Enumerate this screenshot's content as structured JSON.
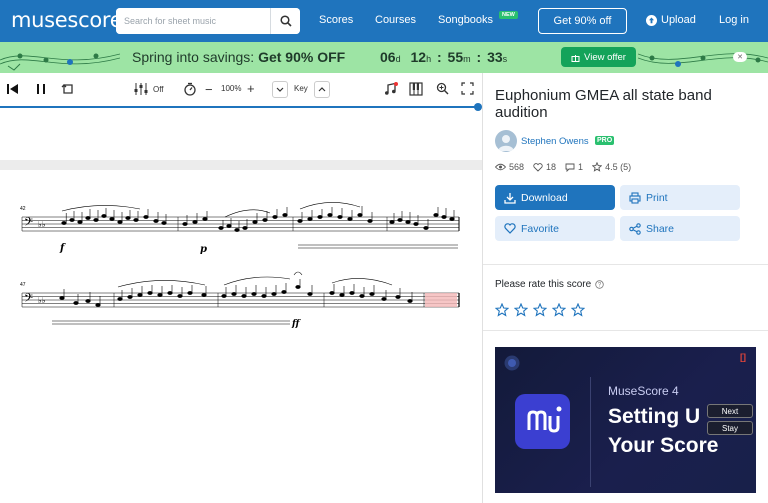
{
  "header": {
    "logo": "musescore",
    "search_placeholder": "Search for sheet music",
    "nav": [
      "Scores",
      "Courses",
      "Songbooks"
    ],
    "new_badge": "NEW",
    "cta": "Get 90% off",
    "upload": "Upload",
    "login": "Log in"
  },
  "promo": {
    "text_plain": "Spring into savings: ",
    "text_bold": "Get 90% OFF",
    "days": "06",
    "days_unit": "d",
    "hours": "12",
    "hours_unit": "h",
    "minutes": "55",
    "minutes_unit": "m",
    "seconds": "33",
    "seconds_unit": "s",
    "sep": ":",
    "button": "View offer"
  },
  "toolbar": {
    "mixer_label": "Off",
    "zoom": "100%",
    "key_label": "Key"
  },
  "score": {
    "title": "Euphonium GMEA all state band audition",
    "author": "Stephen Owens",
    "pro_badge": "PRO",
    "views": "568",
    "favorites": "18",
    "comments": "1",
    "rating": "4.5 (5)",
    "system1_measure": "42",
    "system2_measure": "47"
  },
  "actions": {
    "download": "Download",
    "print": "Print",
    "favorite": "Favorite",
    "share": "Share"
  },
  "rating_prompt": "Please rate this score",
  "ad": {
    "subtitle": "MuseScore 4",
    "headline_1": "Setting U",
    "headline_2": "Your Score",
    "next": "Next",
    "stay": "Stay",
    "corner": "[]"
  },
  "colors": {
    "brand_blue": "#1f74bd",
    "promo_green": "#9de4a4",
    "badge_green": "#2ac06f"
  }
}
